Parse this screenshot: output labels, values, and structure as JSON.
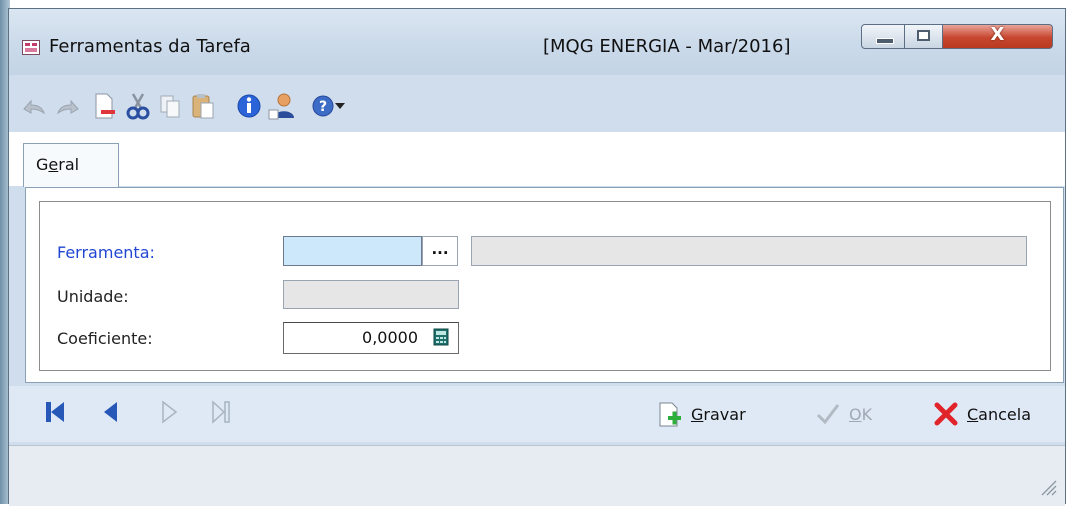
{
  "window": {
    "title": "Ferramentas da Tarefa",
    "context": "[MQG ENERGIA - Mar/2016]",
    "close_glyph": "X"
  },
  "toolbar": {
    "icons": [
      "undo-icon",
      "redo-icon",
      "new-document-icon",
      "cut-icon",
      "copy-icon",
      "paste-icon",
      "info-icon",
      "user-icon",
      "help-icon",
      "dropdown-arrow-icon"
    ]
  },
  "tabs": [
    {
      "label_pre": "G",
      "label_access": "e",
      "label_post": "ral",
      "active": true
    }
  ],
  "form": {
    "ferramenta": {
      "label": "Ferramenta:",
      "code_value": "",
      "ellipsis": "...",
      "description_value": ""
    },
    "unidade": {
      "label": "Unidade:",
      "value": ""
    },
    "coeficiente": {
      "label": "Coeficiente:",
      "value": "0,0000"
    }
  },
  "actions": {
    "gravar": {
      "access": "G",
      "rest": "ravar"
    },
    "ok": {
      "access": "O",
      "rest": "K"
    },
    "cancela": {
      "access": "C",
      "rest": "ancela"
    }
  },
  "colors": {
    "required_label": "#2046d3",
    "focus_field": "#cde8fb",
    "nav_arrows": "#2758b8"
  }
}
